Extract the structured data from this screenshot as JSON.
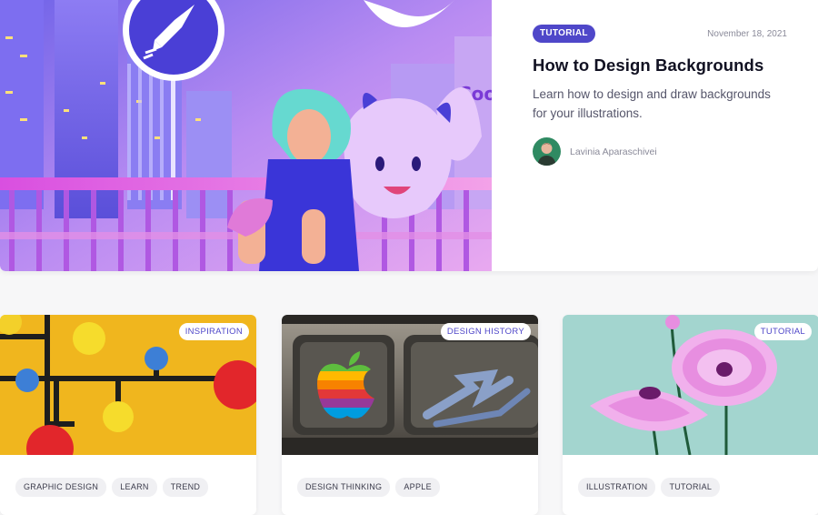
{
  "featured": {
    "badge": "TUTORIAL",
    "date": "November 18, 2021",
    "title": "How to Design Backgrounds",
    "description": "Learn how to design and draw backgrounds for your illustrations.",
    "author": "Lavinia Aparaschivei",
    "image_icon": "rocket-icon",
    "sign_text": "Cool"
  },
  "cards": [
    {
      "badge": "INSPIRATION",
      "tags": [
        "GRAPHIC DESIGN",
        "LEARN",
        "TREND"
      ]
    },
    {
      "badge": "DESIGN HISTORY",
      "tags": [
        "DESIGN THINKING",
        "APPLE"
      ]
    },
    {
      "badge": "TUTORIAL",
      "tags": [
        "ILLUSTRATION",
        "TUTORIAL"
      ]
    }
  ],
  "colors": {
    "accent": "#4f47c9",
    "card_bg": "#ffffff",
    "tag_bg": "#f0f0f3",
    "inspiration_bg": "#f0b61e",
    "tutorial_bg": "#a3d5cf"
  }
}
